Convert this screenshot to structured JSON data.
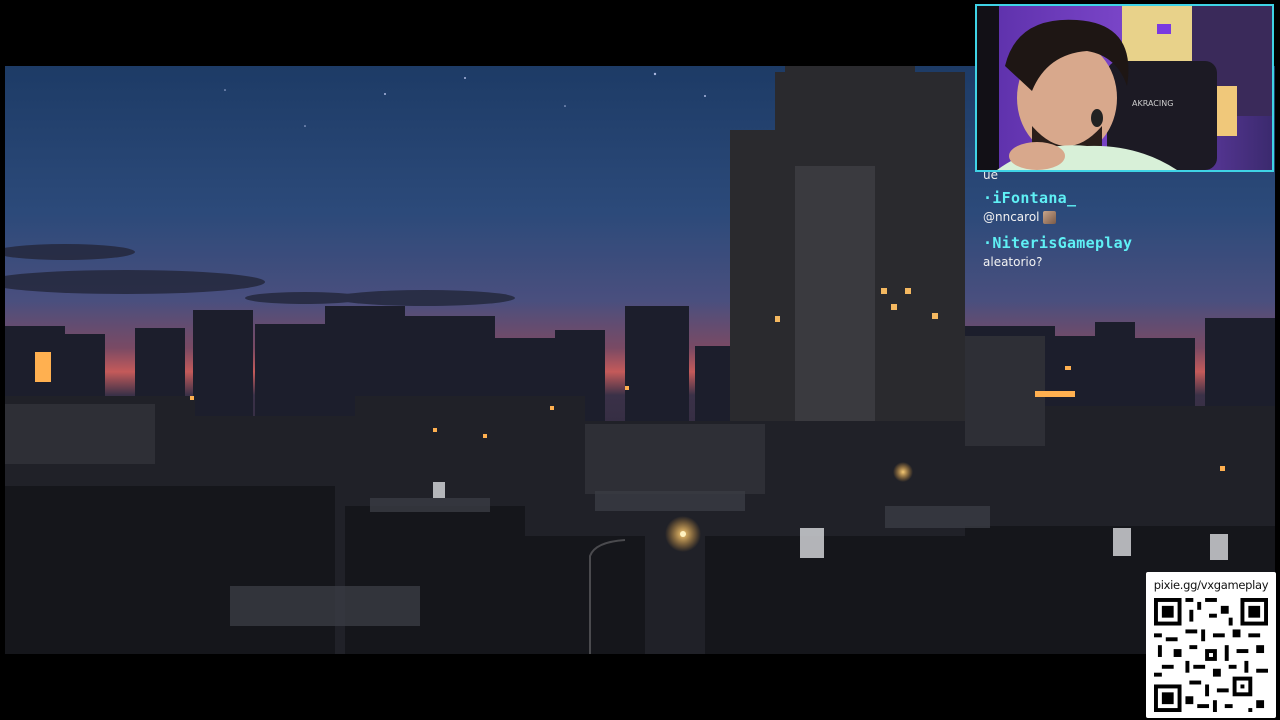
{
  "stream": {
    "scene_description": "",
    "chat": {
      "partial_message": "ue",
      "messages": [
        {
          "username": "·iFontana_",
          "text": "@nncarol",
          "emote": "emote"
        },
        {
          "username": "·NiterisGameplay",
          "text": "aleatorio?",
          "emote": ""
        }
      ]
    },
    "donation": {
      "url": "pixie.gg/vxgameplay"
    },
    "webcam": {
      "chair_brand": "AKRACING"
    }
  }
}
